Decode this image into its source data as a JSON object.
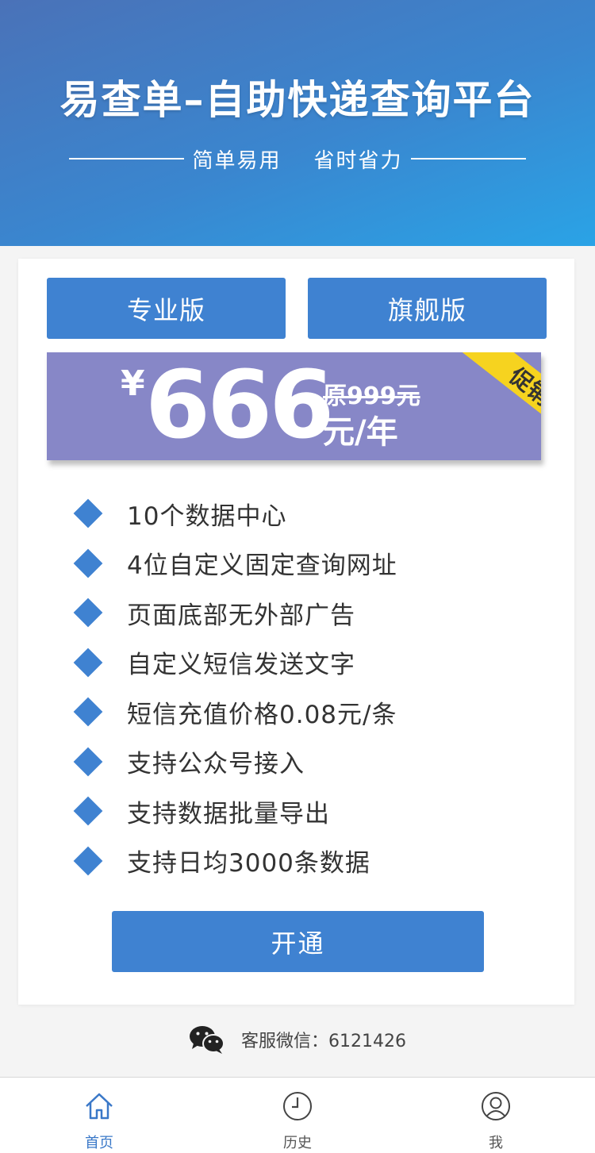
{
  "header": {
    "title": "易查单–自助快递查询平台",
    "subtitle": "简单易用    省时省力"
  },
  "plans": {
    "pro_label": "专业版",
    "flagship_label": "旗舰版"
  },
  "price": {
    "currency": "¥",
    "amount": "666",
    "original": "原999元",
    "unit": "元/年",
    "badge": "促销"
  },
  "features": [
    "10个数据中心",
    "4位自定义固定查询网址",
    "页面底部无外部广告",
    "自定义短信发送文字",
    "短信充值价格0.08元/条",
    "支持公众号接入",
    "支持数据批量导出",
    "支持日均3000条数据"
  ],
  "open_button_label": "开通",
  "contact": {
    "text": "客服微信：6121426"
  },
  "nav": {
    "home": "首页",
    "history": "历史",
    "me": "我"
  },
  "colors": {
    "accent": "#3f82d1",
    "price_box": "#8787c7",
    "badge": "#f6d31f"
  }
}
